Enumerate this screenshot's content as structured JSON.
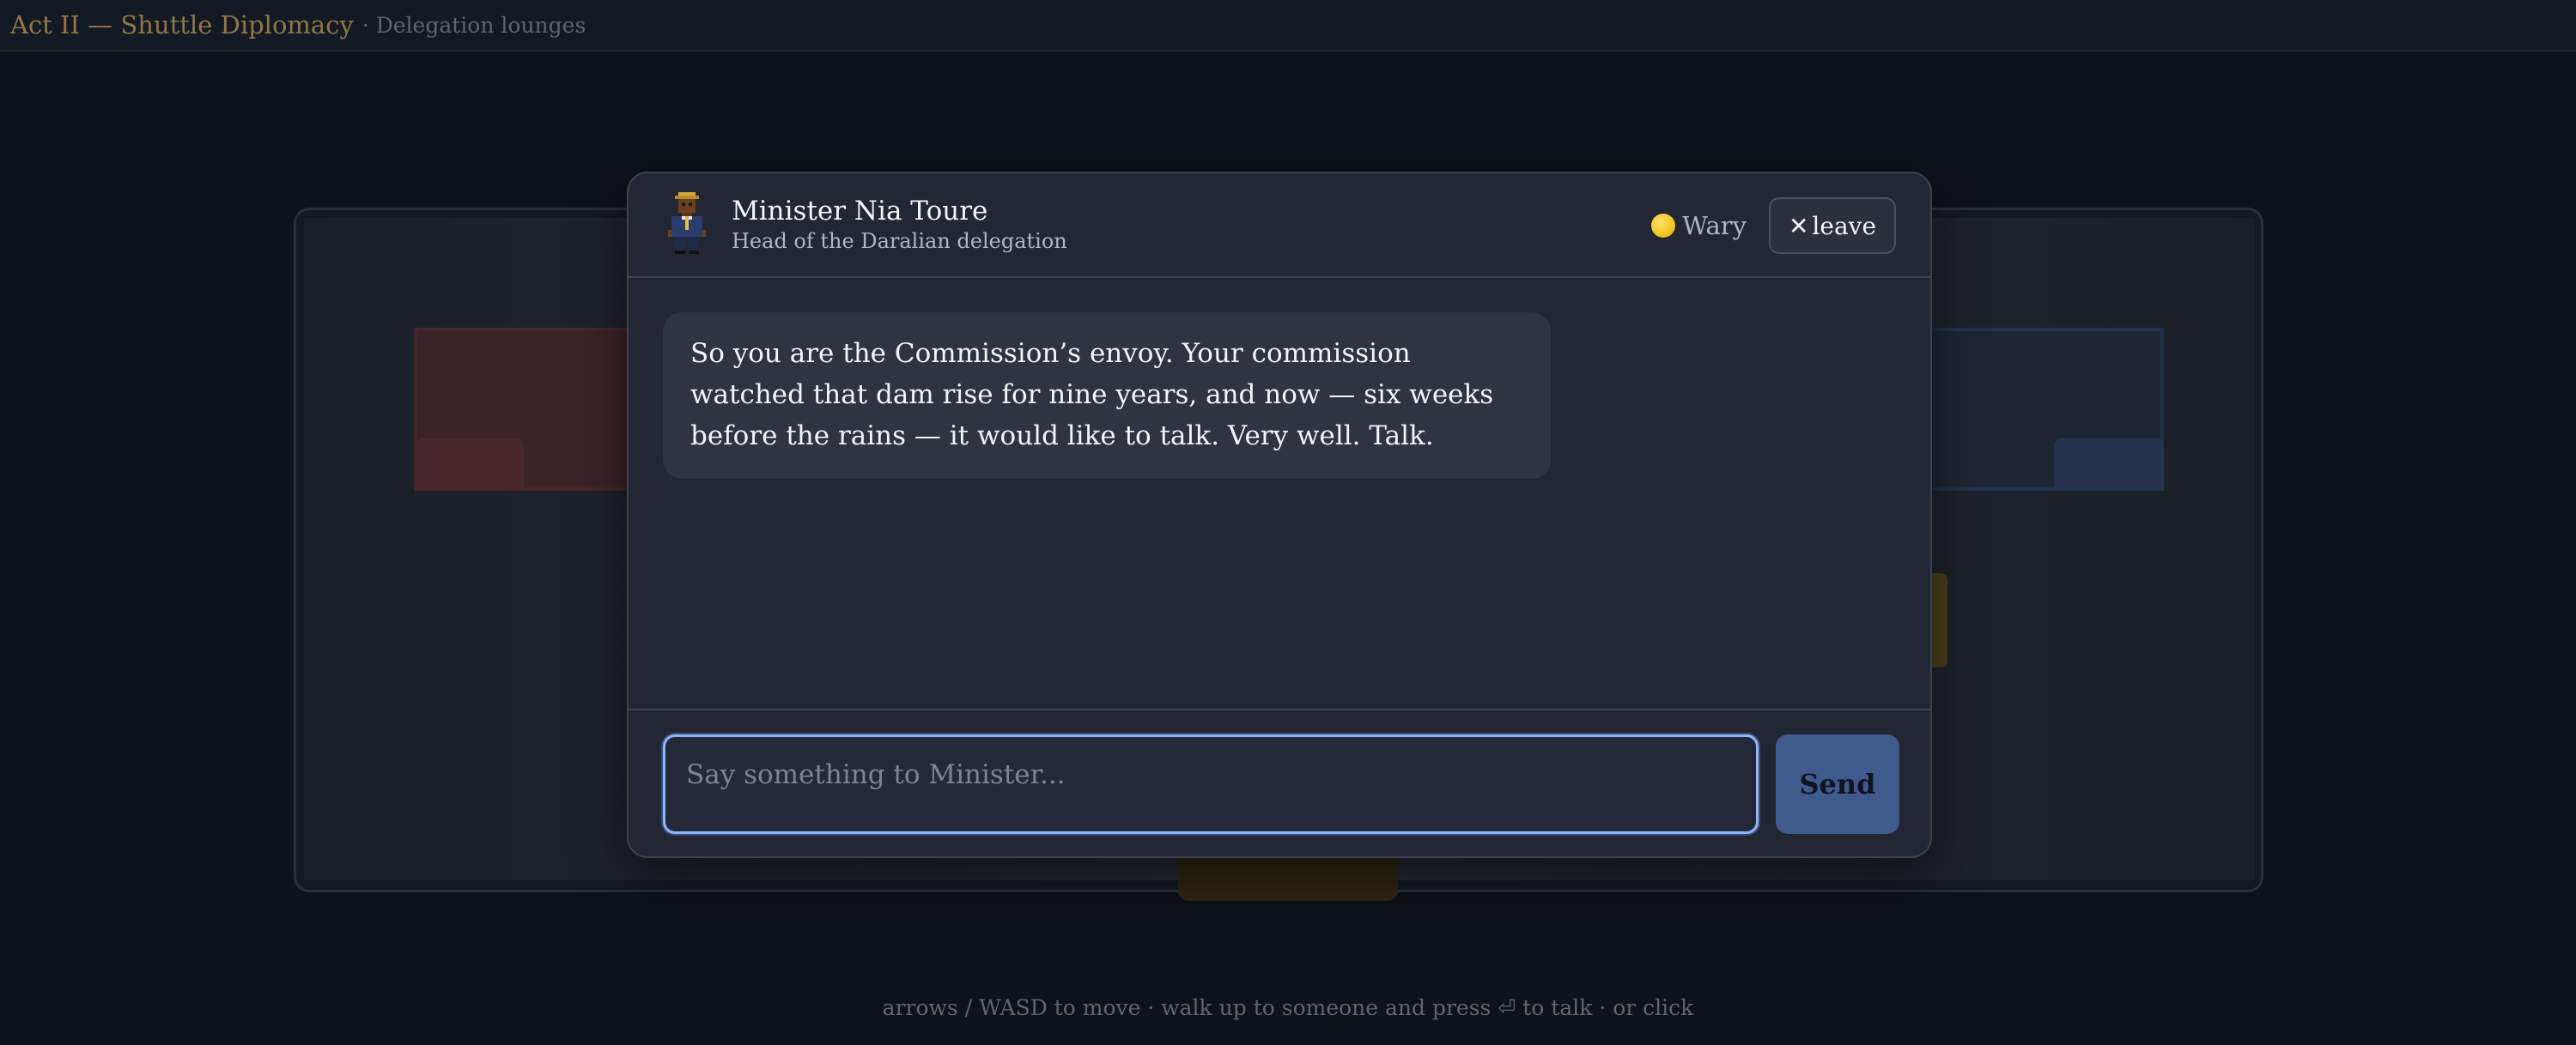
{
  "topbar": {
    "act_title": "Act II — Shuttle Diplomacy",
    "scene_label": "· Delegation lounges"
  },
  "dialog": {
    "npc_name": "Minister Nia Toure",
    "npc_title": "Head of the Daralian delegation",
    "portrait_icon": "pixel-minister-portrait-icon",
    "mood": {
      "icon": "yellow-circle-icon",
      "color": "#f3c623",
      "label": "Wary"
    },
    "leave_button": {
      "icon": "close-icon",
      "label": "leave"
    },
    "messages": [
      {
        "speaker": "Minister Nia Toure",
        "text": "So you are the Commission’s envoy. Your commission watched that dam rise for nine years, and now — six weeks before the rains — it would like to talk. Very well. Talk."
      }
    ],
    "input": {
      "placeholder": "Say something to Minister...",
      "value": ""
    },
    "send_label": "Send"
  },
  "footer": {
    "hint": "arrows / WASD to move · walk up to someone and press ⏎ to talk · or click"
  },
  "colors": {
    "accent": "#8eb6ff",
    "send_button": "#3f5a8d",
    "act_title": "#8f7746",
    "mood_wary": "#f3c623"
  }
}
